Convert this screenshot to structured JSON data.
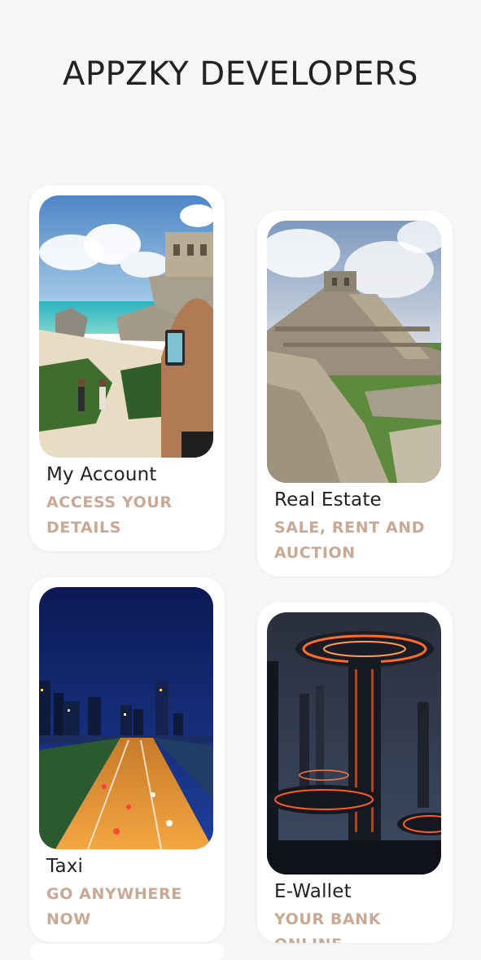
{
  "header": {
    "title": "APPZKY DEVELOPERS"
  },
  "cards": [
    {
      "label": "My Account",
      "subtitle": "ACCESS YOUR DETAILS",
      "image": "beach-ruins-photo"
    },
    {
      "label": "Real Estate",
      "subtitle": "SALE, RENT AND AUCTION",
      "image": "pyramid-ruins-photo"
    },
    {
      "label": "Taxi",
      "subtitle": "GO ANYWHERE NOW",
      "image": "night-highway-city-photo"
    },
    {
      "label": "E-Wallet",
      "subtitle": "YOUR BANK ONLINE",
      "image": "futuristic-city-photo"
    }
  ],
  "colors": {
    "background": "#f6f6f6",
    "card": "#ffffff",
    "title_text": "#222222",
    "subtitle_text": "#c9a994"
  }
}
